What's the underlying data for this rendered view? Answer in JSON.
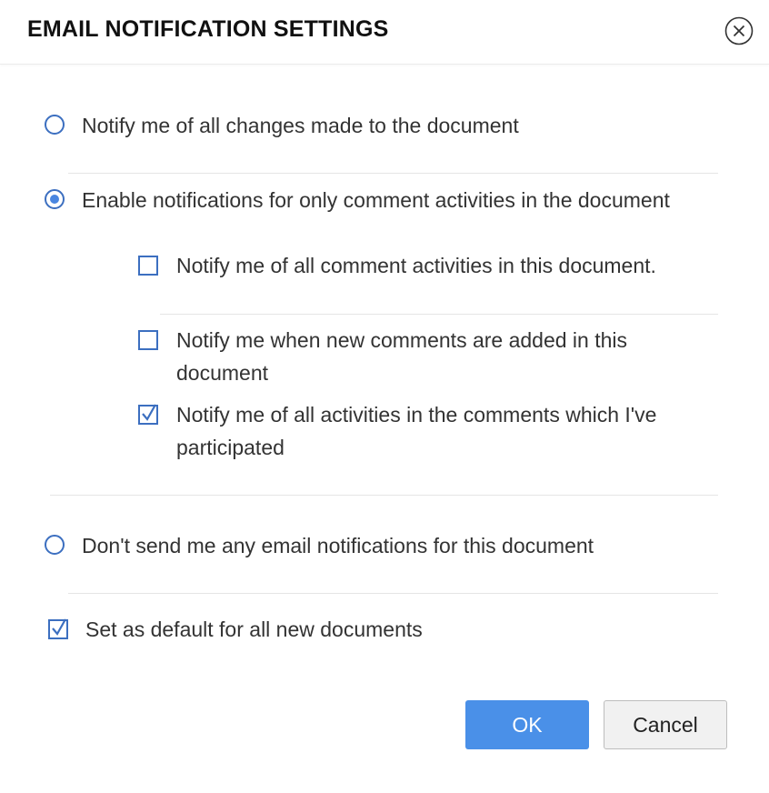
{
  "dialog": {
    "title": "EMAIL NOTIFICATION SETTINGS",
    "close_icon": "close-circle-icon"
  },
  "options": {
    "notify_all_changes": {
      "label": "Notify me of all changes made to the document",
      "selected": false
    },
    "comment_only": {
      "label": "Enable notifications for only comment activities in the document",
      "selected": true
    },
    "no_notifications": {
      "label": "Don't send me any email notifications for this document",
      "selected": false
    }
  },
  "comment_suboptions": {
    "all_comment_activities": {
      "label": "Notify me of all comment activities in this document.",
      "checked": false
    },
    "new_comments": {
      "line1": "Notify me when new comments are added in this",
      "line2": "document",
      "checked": false
    },
    "participated": {
      "line1": "Notify me of all activities in the comments which I've",
      "line2": "participated",
      "checked": true
    }
  },
  "default_setting": {
    "label": "Set as default for all new documents",
    "checked": true
  },
  "buttons": {
    "ok": "OK",
    "cancel": "Cancel"
  },
  "colors": {
    "accent": "#4a90e8",
    "control_border": "#3c6fc0",
    "radio_dot": "#4a86e0",
    "cancel_bg": "#f1f1f1"
  }
}
